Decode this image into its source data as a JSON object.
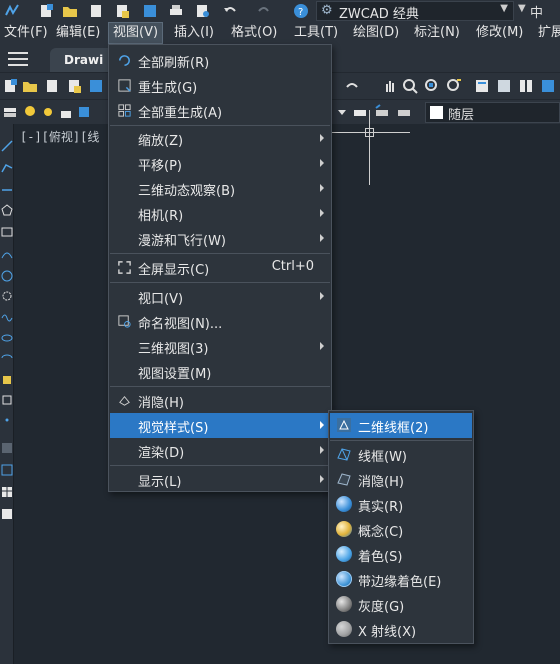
{
  "titlebar": {
    "workspace": "ZWCAD 经典",
    "language": "中"
  },
  "menubar": {
    "items": [
      {
        "label": "文件(F)"
      },
      {
        "label": "编辑(E)"
      },
      {
        "label": "视图(V)"
      },
      {
        "label": "插入(I)"
      },
      {
        "label": "格式(O)"
      },
      {
        "label": "工具(T)"
      },
      {
        "label": "绘图(D)"
      },
      {
        "label": "标注(N)"
      },
      {
        "label": "修改(M)"
      },
      {
        "label": "扩展"
      }
    ]
  },
  "tabs": {
    "active_doc": "Drawi"
  },
  "toolbar": {
    "layer_value": "随层"
  },
  "viewport": {
    "label": "[-][俯视][线"
  },
  "view_menu": {
    "items": [
      {
        "label": "全部刷新(R)",
        "icon": "refresh-icon"
      },
      {
        "label": "重生成(G)",
        "icon": "regen-icon"
      },
      {
        "label": "全部重生成(A)",
        "icon": "regen-all-icon"
      },
      {
        "label": "缩放(Z)",
        "submenu": true
      },
      {
        "label": "平移(P)",
        "submenu": true
      },
      {
        "label": "三维动态观察(B)",
        "submenu": true
      },
      {
        "label": "相机(R)",
        "submenu": true
      },
      {
        "label": "漫游和飞行(W)",
        "submenu": true
      },
      {
        "label": "全屏显示(C)",
        "shortcut": "Ctrl+0",
        "icon": "fullscreen-icon"
      },
      {
        "label": "视口(V)",
        "submenu": true
      },
      {
        "label": "命名视图(N)...",
        "icon": "named-view-icon"
      },
      {
        "label": "三维视图(3)",
        "submenu": true
      },
      {
        "label": "视图设置(M)"
      },
      {
        "label": "消隐(H)",
        "icon": "hide-icon"
      },
      {
        "label": "视觉样式(S)",
        "submenu": true,
        "highlighted": true
      },
      {
        "label": "渲染(D)",
        "submenu": true
      },
      {
        "label": "显示(L)",
        "submenu": true
      }
    ]
  },
  "visual_style_submenu": {
    "items": [
      {
        "label": "二维线框(2)",
        "highlighted": true,
        "icon": "2d-wireframe-icon"
      },
      {
        "label": "线框(W)",
        "icon": "wireframe-icon"
      },
      {
        "label": "消隐(H)",
        "icon": "hidden-icon"
      },
      {
        "label": "真实(R)",
        "icon": "realistic-icon",
        "color": "#3a8fd9"
      },
      {
        "label": "概念(C)",
        "icon": "conceptual-icon",
        "color": "#e0b23a"
      },
      {
        "label": "着色(S)",
        "icon": "shaded-icon",
        "color": "#4aa3e6"
      },
      {
        "label": "带边缘着色(E)",
        "icon": "shaded-edges-icon",
        "color": "#3d93d6"
      },
      {
        "label": "灰度(G)",
        "icon": "grayscale-icon",
        "color": "#8a8a8a"
      },
      {
        "label": "X 射线(X)",
        "icon": "xray-icon",
        "color": "#b9b9b9"
      }
    ]
  }
}
